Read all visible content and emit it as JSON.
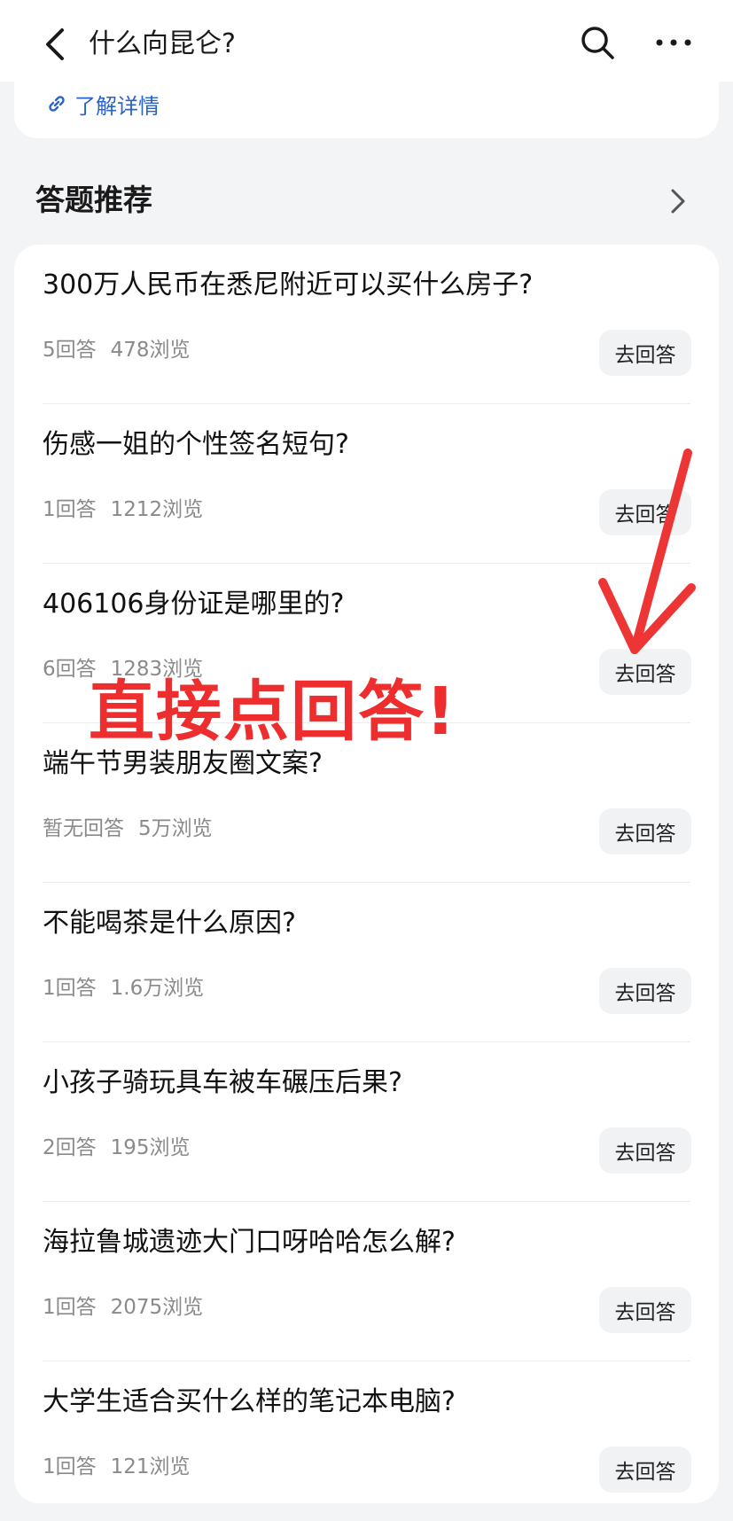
{
  "header": {
    "title": "什么向昆仑?"
  },
  "top_card": {
    "link_label": "了解详情"
  },
  "section": {
    "title": "答题推荐"
  },
  "questions": [
    {
      "title": "300万人民币在悉尼附近可以买什么房子?",
      "answers": "5回答",
      "views": "478浏览",
      "button": "去回答"
    },
    {
      "title": "伤感一姐的个性签名短句?",
      "answers": "1回答",
      "views": "1212浏览",
      "button": "去回答"
    },
    {
      "title": "406106身份证是哪里的?",
      "answers": "6回答",
      "views": "1283浏览",
      "button": "去回答"
    },
    {
      "title": "端午节男装朋友圈文案?",
      "answers": "暂无回答",
      "views": "5万浏览",
      "button": "去回答"
    },
    {
      "title": "不能喝茶是什么原因?",
      "answers": "1回答",
      "views": "1.6万浏览",
      "button": "去回答"
    },
    {
      "title": "小孩子骑玩具车被车碾压后果?",
      "answers": "2回答",
      "views": "195浏览",
      "button": "去回答"
    },
    {
      "title": "海拉鲁城遗迹大门口呀哈哈怎么解?",
      "answers": "1回答",
      "views": "2075浏览",
      "button": "去回答"
    },
    {
      "title": "大学生适合买什么样的笔记本电脑?",
      "answers": "1回答",
      "views": "121浏览",
      "button": "去回答"
    }
  ],
  "annotation": {
    "text": "直接点回答!",
    "color": "#ee2e2e"
  },
  "colors": {
    "link": "#2a62c9",
    "background": "#f3f4f6",
    "button_bg": "#f1f2f4"
  }
}
